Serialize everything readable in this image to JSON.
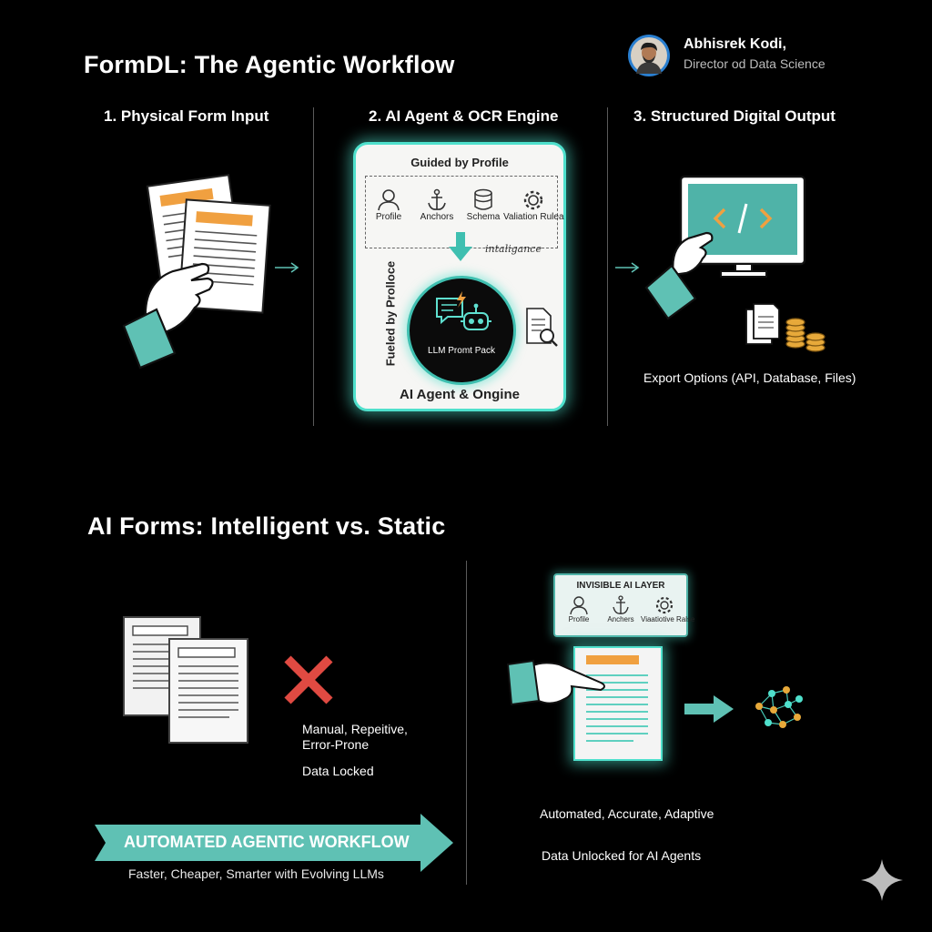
{
  "header": {
    "title": "FormDL: The Agentic Workflow",
    "author_name": "Abhisrek Kodi,",
    "author_role": "Director od Data Science"
  },
  "workflow": {
    "steps": [
      {
        "label": "1. Physical Form Input"
      },
      {
        "label": "2. AI Agent & OCR Engine"
      },
      {
        "label": "3. Structured Digital Output"
      }
    ],
    "engine": {
      "guided_label": "Guided by Profile",
      "items": [
        "Profile",
        "Anchors",
        "Schema",
        "Valiation Rulea"
      ],
      "intelligence_label": "intaligance",
      "side_label": "Fueled by Prolloce",
      "core_label": "LLM Promt Pack",
      "footer_label": "AI Agent & Ongine"
    },
    "export_label": "Export Options (API, Database, Files)"
  },
  "comparison": {
    "title": "AI Forms: Intelligent vs. Static",
    "static": {
      "line1": "Manual, Repeitive,",
      "line2": "Error-Prone",
      "line3": "Data Locked"
    },
    "banner": {
      "label": "AUTOMATED AGENTIC WORKFLOW",
      "subtitle": "Faster, Cheaper, Smarter with Evolving LLMs"
    },
    "ai_layer": {
      "title": "INVISIBLE AI LAYER",
      "items": [
        "Profile",
        "Anchers",
        "Viaatiotive Ralse"
      ]
    },
    "intelligent": {
      "line1": "Automated, Accurate, Adaptive",
      "line2": "Data Unlocked for AI Agents"
    }
  },
  "colors": {
    "teal": "#5fc1b4",
    "orange": "#f0a040",
    "red": "#e04a42",
    "gold": "#e7a93a"
  }
}
